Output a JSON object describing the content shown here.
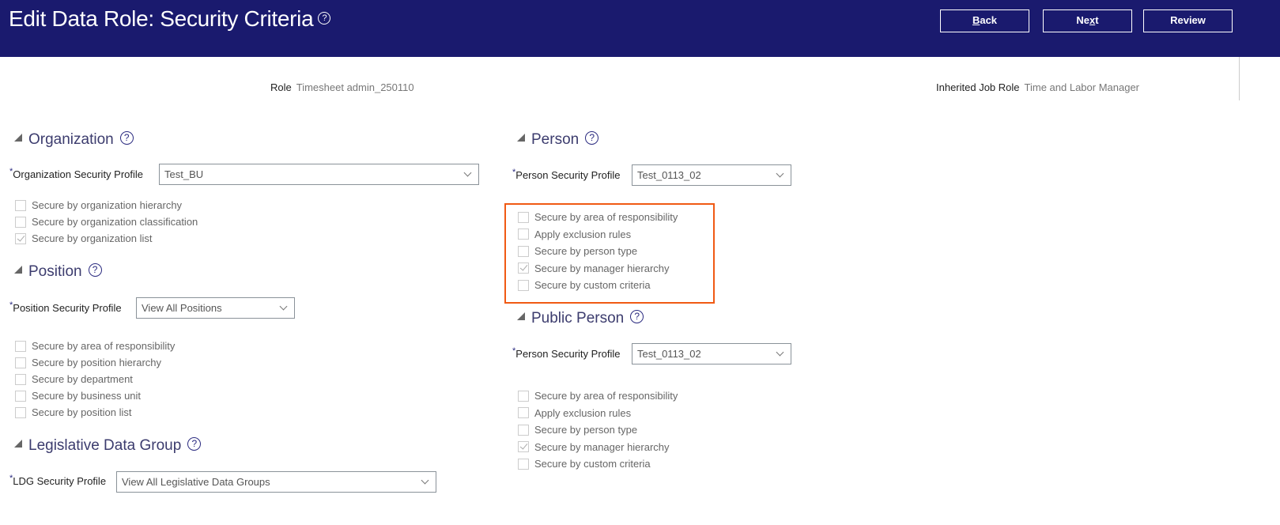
{
  "header": {
    "title": "Edit Data Role: Security Criteria",
    "help": "?",
    "buttons": {
      "back": {
        "pre": "",
        "u": "B",
        "post": "ack"
      },
      "next": {
        "pre": "Ne",
        "u": "x",
        "post": "t"
      },
      "review": "Review"
    },
    "color": "#1a1a6e"
  },
  "info": {
    "role_label": "Role",
    "role_value": "Timesheet admin_250110",
    "inherited_label": "Inherited Job Role",
    "inherited_value": "Time and Labor Manager"
  },
  "help_icon": "?",
  "required_mark": "*",
  "sections": {
    "organization": {
      "title": "Organization",
      "profile_label": "Organization Security Profile",
      "profile_value": "Test_BU",
      "checks": [
        {
          "label": "Secure by organization hierarchy",
          "checked": false
        },
        {
          "label": "Secure by organization classification",
          "checked": false
        },
        {
          "label": "Secure by organization list",
          "checked": true
        }
      ]
    },
    "position": {
      "title": "Position",
      "profile_label": "Position Security Profile",
      "profile_value": "View All Positions",
      "checks": [
        {
          "label": "Secure by area of responsibility",
          "checked": false
        },
        {
          "label": "Secure by position hierarchy",
          "checked": false
        },
        {
          "label": "Secure by department",
          "checked": false
        },
        {
          "label": "Secure by business unit",
          "checked": false
        },
        {
          "label": "Secure by position list",
          "checked": false
        }
      ]
    },
    "ldg": {
      "title": "Legislative Data Group",
      "profile_label": "LDG Security Profile",
      "profile_value": "View All Legislative Data Groups"
    },
    "person": {
      "title": "Person",
      "profile_label": "Person Security Profile",
      "profile_value": "Test_0113_02",
      "checks": [
        {
          "label": "Secure by area of responsibility",
          "checked": false
        },
        {
          "label": "Apply exclusion rules",
          "checked": false
        },
        {
          "label": "Secure by person type",
          "checked": false
        },
        {
          "label": "Secure by manager hierarchy",
          "checked": true
        },
        {
          "label": "Secure by custom criteria",
          "checked": false
        }
      ]
    },
    "public_person": {
      "title": "Public Person",
      "profile_label": "Person Security Profile",
      "profile_value": "Test_0113_02",
      "checks": [
        {
          "label": "Secure by area of responsibility",
          "checked": false
        },
        {
          "label": "Apply exclusion rules",
          "checked": false
        },
        {
          "label": "Secure by person type",
          "checked": false
        },
        {
          "label": "Secure by manager hierarchy",
          "checked": true
        },
        {
          "label": "Secure by custom criteria",
          "checked": false
        }
      ]
    }
  },
  "highlight_color": "#f05a14"
}
